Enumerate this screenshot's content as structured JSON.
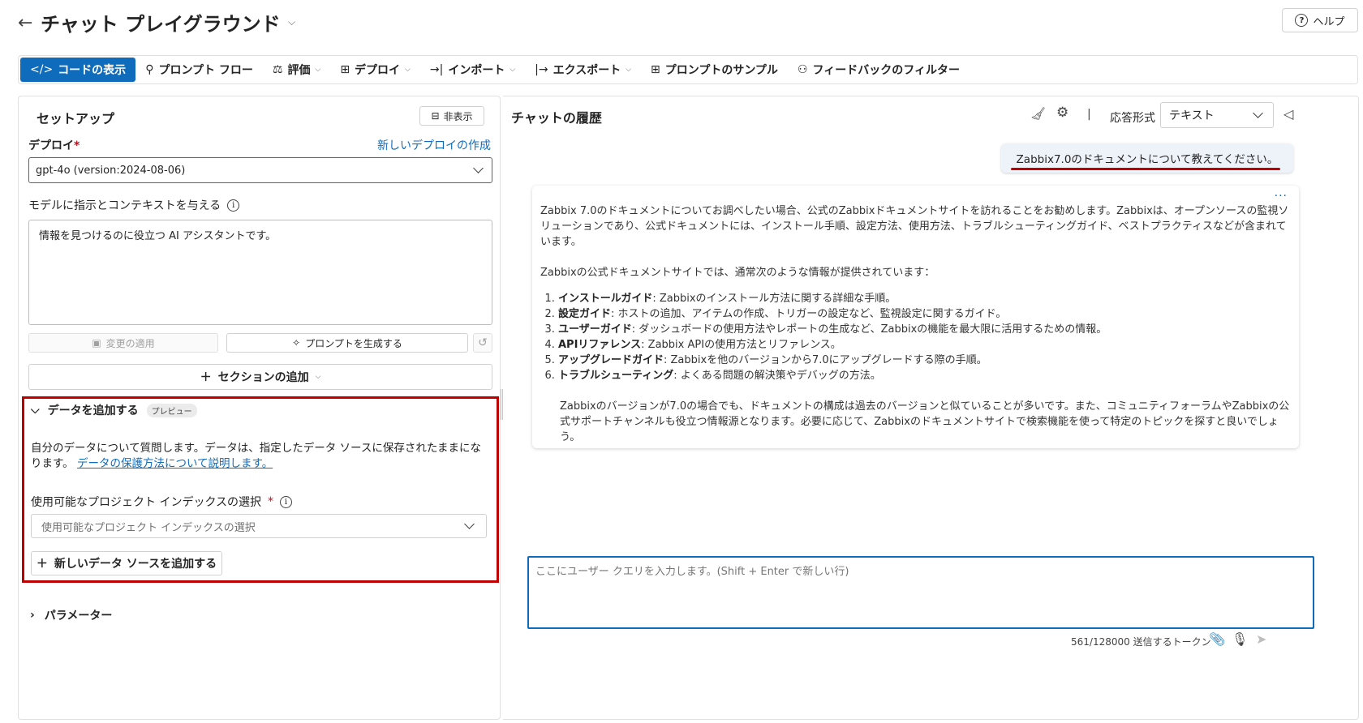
{
  "header": {
    "title": "チャット プレイグラウンド",
    "help_label": "ヘルプ"
  },
  "toolbar": {
    "items": [
      {
        "label": "コードの表示",
        "icon": "code-icon"
      },
      {
        "label": "プロンプト フロー",
        "icon": "flow-icon"
      },
      {
        "label": "評価",
        "icon": "scale-icon"
      },
      {
        "label": "デプロイ",
        "icon": "deploy-icon"
      },
      {
        "label": "インポート",
        "icon": "import-icon"
      },
      {
        "label": "エクスポート",
        "icon": "export-icon"
      },
      {
        "label": "プロンプトのサンプル",
        "icon": "grid-icon"
      },
      {
        "label": "フィードバックのフィルター",
        "icon": "feedback-icon"
      }
    ]
  },
  "setup": {
    "title": "セットアップ",
    "hide_label": "非表示",
    "deploy_label": "デプロイ",
    "new_deploy_link": "新しいデプロイの作成",
    "deploy_value": "gpt-4o (version:2024-08-06)",
    "instructions_label": "モデルに指示とコンテキストを与える",
    "system_message": "情報を見つけるのに役立つ AI アシスタントです。",
    "apply_label": "変更の適用",
    "generate_label": "プロンプトを生成する",
    "add_section_label": "セクションの追加"
  },
  "data_section": {
    "title": "データを追加する",
    "badge": "プレビュー",
    "description": "自分のデータについて質問します。データは、指定したデータ ソースに保存されたままになります。",
    "link": "データの保護方法について説明します。",
    "index_label": "使用可能なプロジェクト インデックスの選択",
    "index_placeholder": "使用可能なプロジェクト インデックスの選択",
    "add_source_label": "新しいデータ ソースを追加する"
  },
  "parameters_label": "パラメーター",
  "chat": {
    "title": "チャットの履歴",
    "response_format_label": "応答形式",
    "response_format_value": "テキスト",
    "user_message": "Zabbix7.0のドキュメントについて教えてください。",
    "assistant": {
      "para1": "Zabbix 7.0のドキュメントについてお調べしたい場合、公式のZabbixドキュメントサイトを訪れることをお勧めします。Zabbixは、オープンソースの監視ソリューションであり、公式ドキュメントには、インストール手順、設定方法、使用方法、トラブルシューティングガイド、ベストプラクティスなどが含まれています。",
      "para2": "Zabbixの公式ドキュメントサイトでは、通常次のような情報が提供されています：",
      "list": [
        {
          "head": "インストールガイド",
          "text": ": Zabbixのインストール方法に関する詳細な手順。"
        },
        {
          "head": "設定ガイド",
          "text": ": ホストの追加、アイテムの作成、トリガーの設定など、監視設定に関するガイド。"
        },
        {
          "head": "ユーザーガイド",
          "text": ": ダッシュボードの使用方法やレポートの生成など、Zabbixの機能を最大限に活用するための情報。"
        },
        {
          "head": "APIリファレンス",
          "text": ": Zabbix APIの使用方法とリファレンス。"
        },
        {
          "head": "アップグレードガイド",
          "text": ": Zabbixを他のバージョンから7.0にアップグレードする際の手順。"
        },
        {
          "head": "トラブルシューティング",
          "text": ": よくある問題の解決策やデバッグの方法。"
        }
      ],
      "para3": "Zabbixのバージョンが7.0の場合でも、ドキュメントの構成は過去のバージョンと似ていることが多いです。また、コミュニティフォーラムやZabbixの公式サポートチャンネルも役立つ情報源となります。必要に応じて、Zabbixのドキュメントサイトで検索機能を使って特定のトピックを探すと良いでしょう。"
    },
    "query_placeholder": "ここにユーザー クエリを入力します。(Shift + Enter で新しい行)",
    "token_info": "561/128000 送信するトークン"
  },
  "colors": {
    "accent": "#0f6cbd",
    "highlight": "#c00000"
  }
}
